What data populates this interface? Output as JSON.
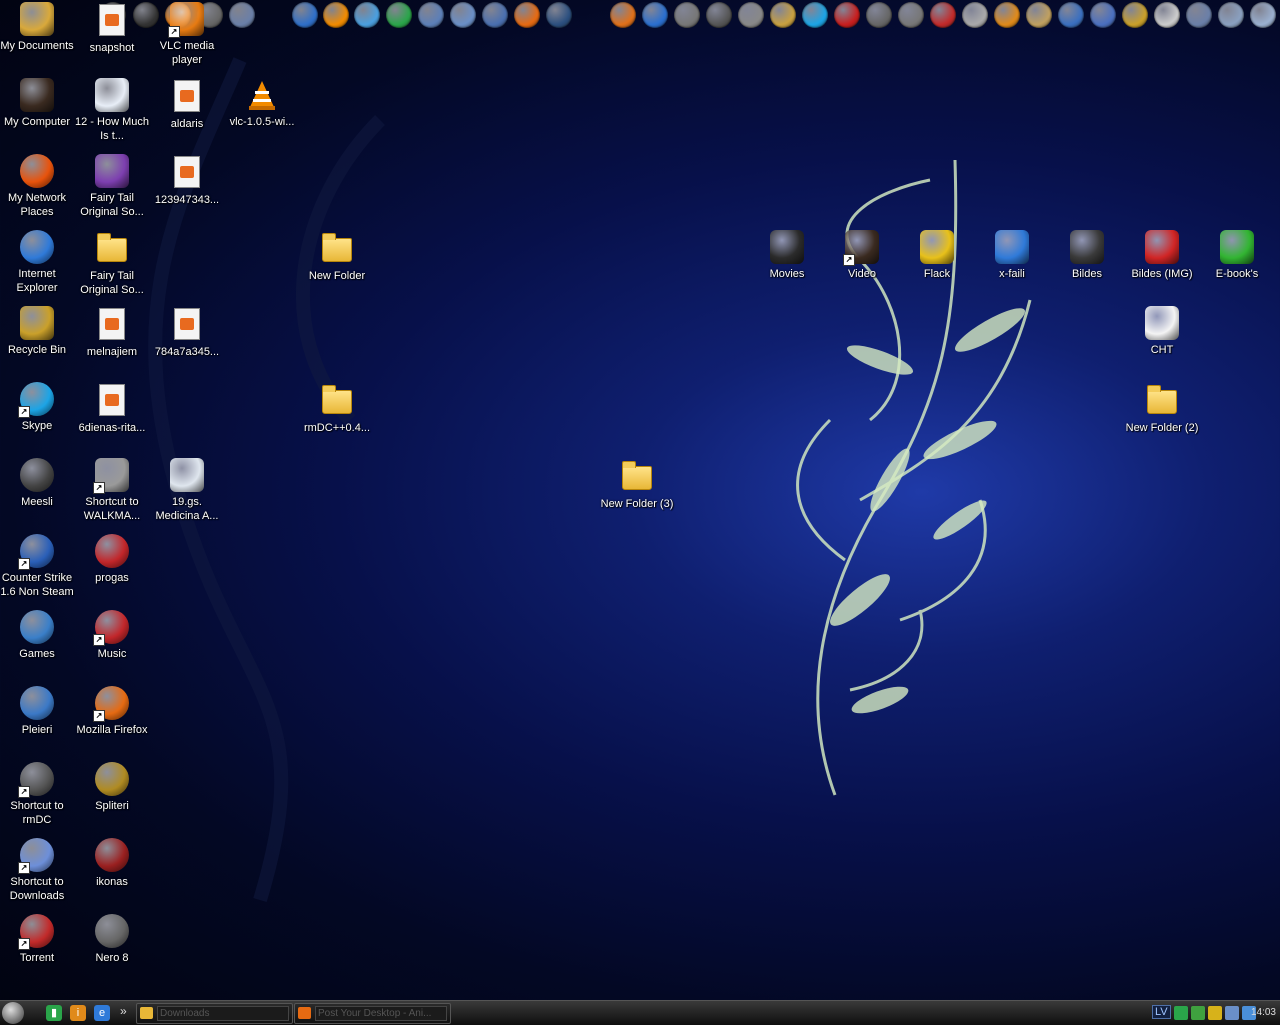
{
  "desktop_icons": [
    {
      "label": "My Documents",
      "color": "#d9a93b",
      "kind": "box",
      "shortcut": false
    },
    {
      "label": "snapshot",
      "color": "",
      "kind": "doc",
      "shortcut": false
    },
    {
      "label": "VLC media player",
      "color": "#e77b12",
      "kind": "box",
      "shortcut": true
    },
    {
      "label": "My Computer",
      "color": "#3a2a20",
      "kind": "box",
      "shortcut": false
    },
    {
      "label": "12 - How Much Is t...",
      "color": "#e8eef7",
      "kind": "box",
      "shortcut": false
    },
    {
      "label": "aldaris",
      "color": "",
      "kind": "doc",
      "shortcut": false
    },
    {
      "label": "vlc-1.0.5-wi...",
      "color": "#f28b00",
      "kind": "cone",
      "shortcut": false
    },
    {
      "label": "My Network Places",
      "color": "#e8530c",
      "kind": "round",
      "shortcut": false
    },
    {
      "label": "Fairy Tail Original So...",
      "color": "#7d3fb0",
      "kind": "box",
      "shortcut": false
    },
    {
      "label": "123947343...",
      "color": "",
      "kind": "doc",
      "shortcut": false
    },
    {
      "label": "Internet Explorer",
      "color": "#2f7ad9",
      "kind": "round",
      "shortcut": false
    },
    {
      "label": "Fairy Tail Original So...",
      "color": "",
      "kind": "folder",
      "shortcut": false
    },
    {
      "label": "New Folder",
      "color": "",
      "kind": "folder",
      "shortcut": false
    },
    {
      "label": "Recycle Bin",
      "color": "#caa02a",
      "kind": "box",
      "shortcut": false
    },
    {
      "label": "melnajiem",
      "color": "",
      "kind": "doc",
      "shortcut": false
    },
    {
      "label": "784a7a345...",
      "color": "",
      "kind": "doc",
      "shortcut": false
    },
    {
      "label": "Skype",
      "color": "#1ca4e6",
      "kind": "round",
      "shortcut": true
    },
    {
      "label": "6dienas-rita...",
      "color": "",
      "kind": "doc",
      "shortcut": false
    },
    {
      "label": "rmDC++0.4...",
      "color": "",
      "kind": "folder",
      "shortcut": false
    },
    {
      "label": "Meesli",
      "color": "#444444",
      "kind": "round",
      "shortcut": false
    },
    {
      "label": "Shortcut to WALKMA...",
      "color": "#9a9a9a",
      "kind": "box",
      "shortcut": true
    },
    {
      "label": "19.gs. Medicina A...",
      "color": "#dfe6ee",
      "kind": "box",
      "shortcut": false
    },
    {
      "label": "New Folder (3)",
      "color": "",
      "kind": "folder",
      "shortcut": false
    },
    {
      "label": "Counter Strike 1.6 Non Steam",
      "color": "#2a5fb8",
      "kind": "round",
      "shortcut": true
    },
    {
      "label": "progas",
      "color": "#c2262a",
      "kind": "round",
      "shortcut": false
    },
    {
      "label": "Games",
      "color": "#3a7fc9",
      "kind": "round",
      "shortcut": false
    },
    {
      "label": "Music",
      "color": "#c2262a",
      "kind": "round",
      "shortcut": true
    },
    {
      "label": "Pleieri",
      "color": "#3b79c7",
      "kind": "round",
      "shortcut": false
    },
    {
      "label": "Mozilla Firefox",
      "color": "#e66a12",
      "kind": "round",
      "shortcut": true
    },
    {
      "label": "Shortcut to rmDC",
      "color": "#555555",
      "kind": "round",
      "shortcut": true
    },
    {
      "label": "Spliteri",
      "color": "#b08b22",
      "kind": "round",
      "shortcut": false
    },
    {
      "label": "Shortcut to Downloads",
      "color": "#6d8fd9",
      "kind": "round",
      "shortcut": true
    },
    {
      "label": "ikonas",
      "color": "#9a2020",
      "kind": "round",
      "shortcut": false
    },
    {
      "label": "Torrent",
      "color": "#c22a2a",
      "kind": "round",
      "shortcut": true
    },
    {
      "label": "Nero 8",
      "color": "#666666",
      "kind": "round",
      "shortcut": false
    },
    {
      "label": "Movies",
      "color": "#2b2b2b",
      "kind": "box",
      "shortcut": false
    },
    {
      "label": "Video",
      "color": "#3a2a20",
      "kind": "box",
      "shortcut": true
    },
    {
      "label": "Flack",
      "color": "#e8c11a",
      "kind": "box",
      "shortcut": false
    },
    {
      "label": "x-faili",
      "color": "#2f7ad9",
      "kind": "box",
      "shortcut": false
    },
    {
      "label": "Bildes",
      "color": "#3a3a3a",
      "kind": "box",
      "shortcut": false
    },
    {
      "label": "Bildes (IMG)",
      "color": "#d12525",
      "kind": "box",
      "shortcut": false
    },
    {
      "label": "E-book's",
      "color": "#32b532",
      "kind": "box",
      "shortcut": false
    },
    {
      "label": "CHT",
      "color": "#f4f4f4",
      "kind": "box",
      "shortcut": false
    },
    {
      "label": "New Folder (2)",
      "color": "",
      "kind": "folder",
      "shortcut": false
    }
  ],
  "quick_launch_icons": [
    {
      "name": "box-icon",
      "color": "#444"
    },
    {
      "name": "media-icon",
      "color": "#333"
    },
    {
      "name": "vlc-icon",
      "color": "#e77b12"
    },
    {
      "name": "tools-icon",
      "color": "#666"
    },
    {
      "name": "tools2-icon",
      "color": "#6a7fa8"
    },
    {
      "name": "play-icon",
      "color": "#2f6fc9"
    },
    {
      "name": "vlc-cone-icon",
      "color": "#f28b00"
    },
    {
      "name": "messenger-icon",
      "color": "#4a9fe0"
    },
    {
      "name": "green-app-icon",
      "color": "#2aa54a"
    },
    {
      "name": "network-icon",
      "color": "#5c7fb8"
    },
    {
      "name": "settings-icon",
      "color": "#6a8fc8"
    },
    {
      "name": "search-icon",
      "color": "#4a6fb0"
    },
    {
      "name": "firefox-icon",
      "color": "#e66a12"
    },
    {
      "name": "terminal-icon",
      "color": "#2b4f7f"
    },
    {
      "name": "half-life-icon",
      "color": "#e0701a"
    },
    {
      "name": "s-app-icon",
      "color": "#2a6fd0"
    },
    {
      "name": "disc-icon",
      "color": "#777"
    },
    {
      "name": "cd-icon",
      "color": "#555"
    },
    {
      "name": "reel-icon",
      "color": "#888"
    },
    {
      "name": "paint-icon",
      "color": "#c8a040"
    },
    {
      "name": "skype-icon",
      "color": "#1ca4e6"
    },
    {
      "name": "pdf-icon",
      "color": "#c81e1e"
    },
    {
      "name": "gear-icon",
      "color": "#666"
    },
    {
      "name": "cog-icon",
      "color": "#777"
    },
    {
      "name": "red-app-icon",
      "color": "#c22a2a"
    },
    {
      "name": "brush-icon",
      "color": "#aaa"
    },
    {
      "name": "info-icon",
      "color": "#e08a1a"
    },
    {
      "name": "wrench-icon",
      "color": "#c0a060"
    },
    {
      "name": "system-icon",
      "color": "#3a6fc0"
    },
    {
      "name": "network2-icon",
      "color": "#4a6fc0"
    },
    {
      "name": "gold-app-icon",
      "color": "#caa02a"
    },
    {
      "name": "clock-icon",
      "color": "#ccc"
    },
    {
      "name": "tray-app-icon",
      "color": "#6a7fa8"
    },
    {
      "name": "notepad-icon",
      "color": "#8aa0c0"
    },
    {
      "name": "folder2-icon",
      "color": "#9ab0d0"
    }
  ],
  "taskbar": {
    "quick": [
      {
        "name": "green-launch-icon",
        "color": "#2aa54a",
        "glyph": "▮"
      },
      {
        "name": "info-launch-icon",
        "color": "#e08a1a",
        "glyph": "i"
      },
      {
        "name": "ie-launch-icon",
        "color": "#2f7ad9",
        "glyph": "e"
      }
    ],
    "more_glyph": "»",
    "tasks": [
      {
        "name": "task-downloads",
        "title": "Downloads",
        "color": "#e8b737"
      },
      {
        "name": "task-firefox",
        "title": "Post Your Desktop - Ani...",
        "color": "#e66a12"
      }
    ],
    "tray": {
      "language": "LV",
      "clock": "14:03",
      "icons": [
        {
          "name": "tray-green-icon",
          "color": "#2aa54a"
        },
        {
          "name": "tray-utorrent-icon",
          "color": "#3fa13f"
        },
        {
          "name": "tray-shield-icon",
          "color": "#d7b21a"
        },
        {
          "name": "tray-network-icon",
          "color": "#6a8fc8"
        },
        {
          "name": "tray-monitor-icon",
          "color": "#4a8fd9"
        }
      ]
    }
  }
}
